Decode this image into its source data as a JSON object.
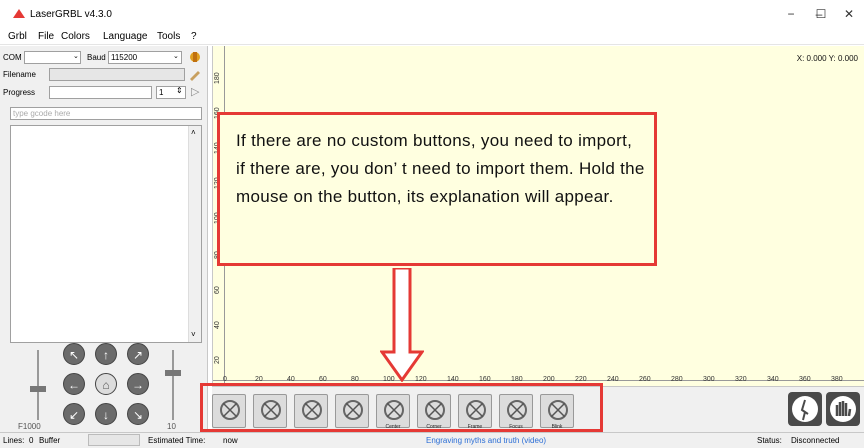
{
  "window": {
    "title": "LaserGRBL v4.3.0"
  },
  "menu": {
    "items": [
      "Grbl",
      "File",
      "Colors",
      "Language",
      "Tools",
      "?"
    ]
  },
  "connection": {
    "com_label": "COM",
    "com_value": "",
    "baud_label": "Baud",
    "baud_value": "115200"
  },
  "file": {
    "filename_label": "Filename",
    "progress_label": "Progress",
    "copies_value": "1"
  },
  "gcode": {
    "placeholder": "type gcode here"
  },
  "jog": {
    "speed_label": "F1000",
    "step_label": "10"
  },
  "canvas": {
    "coords": "X: 0.000 Y: 0.000",
    "v_ticks": [
      "180",
      "160",
      "140",
      "120",
      "100",
      "80",
      "60",
      "40",
      "20",
      "0"
    ],
    "h_ticks": [
      "0",
      "20",
      "40",
      "60",
      "80",
      "100",
      "120",
      "140",
      "160",
      "180",
      "200",
      "220",
      "240",
      "260",
      "280",
      "300",
      "320",
      "340",
      "360",
      "380"
    ]
  },
  "callout": {
    "text": "If there are no custom buttons, you need to import, if there are, you don’ t need to import them. Hold the mouse on the button, its explanation will appear."
  },
  "toolbar": {
    "buttons": [
      {
        "label": "",
        "icon": "laser-icon"
      },
      {
        "label": "",
        "icon": "home-icon"
      },
      {
        "label": "",
        "icon": "unlock-icon"
      },
      {
        "label": "",
        "icon": "globe-icon"
      },
      {
        "label": "Center",
        "icon": "center-icon"
      },
      {
        "label": "Corner",
        "icon": "corner-icon"
      },
      {
        "label": "Frame",
        "icon": "frame-icon"
      },
      {
        "label": "Focus",
        "icon": "focus-icon"
      },
      {
        "label": "Blink",
        "icon": "blink-icon"
      }
    ]
  },
  "status": {
    "lines_label": "Lines:",
    "lines_value": "0",
    "buffer_label": "Buffer",
    "estimated_label": "Estimated Time:",
    "estimated_value": "now",
    "link": "Engraving myths and truth (video)",
    "status_label": "Status:",
    "status_value": "Disconnected"
  },
  "colors": {
    "accent": "#e53935",
    "canvas_bg": "#ffffe0",
    "link": "#2b6ed6"
  }
}
